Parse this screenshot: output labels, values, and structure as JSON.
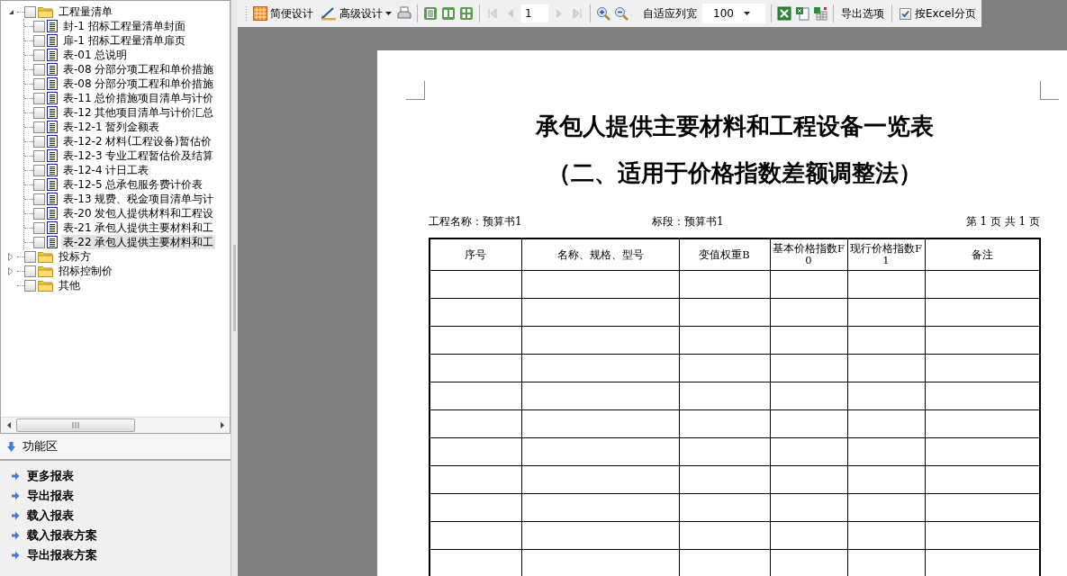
{
  "tree": [
    {
      "label": "工程量清单",
      "kind": "folder",
      "expanded": true,
      "checked": false,
      "children": [
        {
          "label": "封-1 招标工程量清单封面",
          "kind": "report",
          "checked": false,
          "selected": false
        },
        {
          "label": "扉-1 招标工程量清单扉页",
          "kind": "report",
          "checked": false,
          "selected": false
        },
        {
          "label": "表-01 总说明",
          "kind": "report",
          "checked": false,
          "selected": false
        },
        {
          "label": "表-08 分部分项工程和单价措施",
          "kind": "report",
          "checked": false,
          "selected": false
        },
        {
          "label": "表-08 分部分项工程和单价措施",
          "kind": "report",
          "checked": false,
          "selected": false
        },
        {
          "label": "表-11 总价措施项目清单与计价",
          "kind": "report",
          "checked": false,
          "selected": false
        },
        {
          "label": "表-12 其他项目清单与计价汇总",
          "kind": "report",
          "checked": false,
          "selected": false
        },
        {
          "label": "表-12-1 暂列金额表",
          "kind": "report",
          "checked": false,
          "selected": false
        },
        {
          "label": "表-12-2 材料(工程设备)暂估价",
          "kind": "report",
          "checked": false,
          "selected": false
        },
        {
          "label": "表-12-3 专业工程暂估价及结算",
          "kind": "report",
          "checked": false,
          "selected": false
        },
        {
          "label": "表-12-4 计日工表",
          "kind": "report",
          "checked": false,
          "selected": false
        },
        {
          "label": "表-12-5 总承包服务费计价表",
          "kind": "report",
          "checked": false,
          "selected": false
        },
        {
          "label": "表-13 规费、税金项目清单与计",
          "kind": "report",
          "checked": false,
          "selected": false
        },
        {
          "label": "表-20 发包人提供材料和工程设",
          "kind": "report",
          "checked": false,
          "selected": false
        },
        {
          "label": "表-21 承包人提供主要材料和工",
          "kind": "report",
          "checked": false,
          "selected": false
        },
        {
          "label": "表-22 承包人提供主要材料和工",
          "kind": "report",
          "checked": false,
          "selected": true
        }
      ]
    },
    {
      "label": "投标方",
      "kind": "folder",
      "expanded": false,
      "checked": false
    },
    {
      "label": "招标控制价",
      "kind": "folder",
      "expanded": false,
      "checked": false
    },
    {
      "label": "其他",
      "kind": "folder",
      "checked": false
    }
  ],
  "function_panel": {
    "title": "功能区",
    "links": [
      "更多报表",
      "导出报表",
      "载入报表",
      "载入报表方案",
      "导出报表方案"
    ]
  },
  "toolbar": {
    "simple_design": "简便设计",
    "advanced_design": "高级设计",
    "page": "1",
    "fit_columns": "自适应列宽",
    "zoom": "100",
    "export_options": "导出选项",
    "excel_paging": {
      "label": "按Excel分页",
      "checked": true
    }
  },
  "report": {
    "title": "承包人提供主要材料和工程设备一览表",
    "subtitle": "（二、适用于价格指数差额调整法）",
    "project": "工程名称：预算书1",
    "section": "标段：预算书1",
    "page_info": "第 1 页  共 1 页",
    "columns": [
      "序号",
      "名称、规格、型号",
      "变值权重B",
      "基本价格指数F0",
      "现行价格指数F1",
      "备注"
    ]
  }
}
